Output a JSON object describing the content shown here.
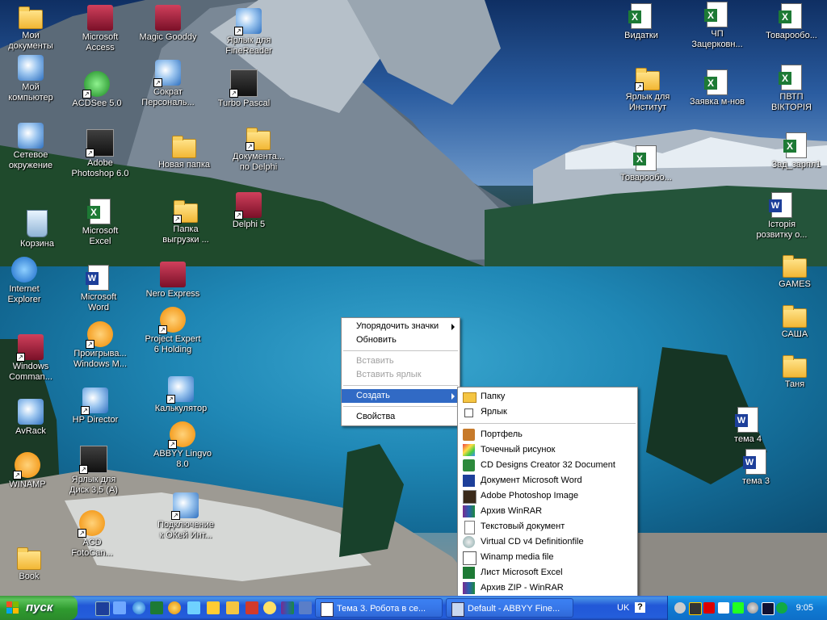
{
  "desktop": {
    "icons": [
      {
        "label": "Мои\nдокументы"
      },
      {
        "label": "Мой\nкомпьютер"
      },
      {
        "label": "Сетевое\nокружение"
      },
      {
        "label": "Корзина"
      },
      {
        "label": "Internet\nExplorer"
      },
      {
        "label": "Windows\nComman..."
      },
      {
        "label": "AvRack"
      },
      {
        "label": "WINAMP"
      },
      {
        "label": "Book"
      },
      {
        "label": "Microsoft\nAccess"
      },
      {
        "label": "ACDSee 5.0"
      },
      {
        "label": "Adobe\nPhotoshop 6.0"
      },
      {
        "label": "Microsoft\nExcel"
      },
      {
        "label": "Microsoft\nWord"
      },
      {
        "label": "Проигрыва...\nWindows M..."
      },
      {
        "label": "HP Director"
      },
      {
        "label": "Ярлык для\nДиск 3,5 (А)"
      },
      {
        "label": "ACD\nFotoCan..."
      },
      {
        "label": "Magic Gooddy"
      },
      {
        "label": "Сократ\nПерсональ..."
      },
      {
        "label": "Новая папка"
      },
      {
        "label": "Папка\nвыгрузки ..."
      },
      {
        "label": "Nero Express"
      },
      {
        "label": "Project Expert\n6 Holding"
      },
      {
        "label": "Калькулятор"
      },
      {
        "label": "ABBYY Lingvo\n8.0"
      },
      {
        "label": "Подключение\nк ОКей Инт..."
      },
      {
        "label": "Ярлык для\nFineReader"
      },
      {
        "label": "Turbo Pascal"
      },
      {
        "label": "Документа...\nпо Delphi"
      },
      {
        "label": "Delphi 5"
      },
      {
        "label": "Видатки"
      },
      {
        "label": "ЧП\nЗацерковн..."
      },
      {
        "label": "Товарообо..."
      },
      {
        "label": "Ярлык для\nИнститут"
      },
      {
        "label": "Заявка м-нов"
      },
      {
        "label": "ПВТП\nВІКТОРІЯ"
      },
      {
        "label": "Товарообо..."
      },
      {
        "label": "Зад_зарпл1"
      },
      {
        "label": "Історія\nрозвитку о..."
      },
      {
        "label": "GAMES"
      },
      {
        "label": "САША"
      },
      {
        "label": "Таня"
      },
      {
        "label": "тема 4"
      },
      {
        "label": "тема 3"
      }
    ]
  },
  "context_menu": {
    "items": [
      {
        "label": "Упорядочить значки",
        "has_submenu": true,
        "enabled": true
      },
      {
        "label": "Обновить",
        "enabled": true
      },
      {
        "label": "Вставить",
        "enabled": false
      },
      {
        "label": "Вставить ярлык",
        "enabled": false
      },
      {
        "label": "Создать",
        "has_submenu": true,
        "enabled": true,
        "highlighted": true
      },
      {
        "label": "Свойства",
        "enabled": true
      }
    ]
  },
  "create_submenu": {
    "items": [
      {
        "label": "Папку",
        "icon": "folder-icon"
      },
      {
        "label": "Ярлык",
        "icon": "shortcut-icon"
      },
      {
        "label": "Портфель",
        "icon": "briefcase-icon"
      },
      {
        "label": "Точечный рисунок",
        "icon": "bitmap-icon"
      },
      {
        "label": "CD Designs Creator 32 Document",
        "icon": "cd-designs-icon"
      },
      {
        "label": "Документ Microsoft Word",
        "icon": "word-doc-icon"
      },
      {
        "label": "Adobe Photoshop Image",
        "icon": "photoshop-icon"
      },
      {
        "label": "Архив WinRAR",
        "icon": "winrar-icon"
      },
      {
        "label": "Текстовый документ",
        "icon": "text-doc-icon"
      },
      {
        "label": "Virtual CD v4 Definitionfile",
        "icon": "virtual-cd-icon"
      },
      {
        "label": "Winamp media file",
        "icon": "winamp-file-icon"
      },
      {
        "label": "Лист Microsoft Excel",
        "icon": "excel-sheet-icon"
      },
      {
        "label": "Архив ZIP - WinRAR",
        "icon": "zip-icon"
      }
    ]
  },
  "taskbar": {
    "start_label": "пуск",
    "tasks": [
      {
        "label": "Тема 3. Робота в се..."
      },
      {
        "label": "Default - ABBYY Fine..."
      }
    ],
    "language": "UK",
    "help_glyph": "?",
    "clock": "9:05"
  },
  "colors": {
    "taskbar_blue": "#245edb",
    "start_green": "#3c9a3c",
    "menu_highlight": "#316ac5",
    "tray_blue": "#0e6fc8"
  }
}
